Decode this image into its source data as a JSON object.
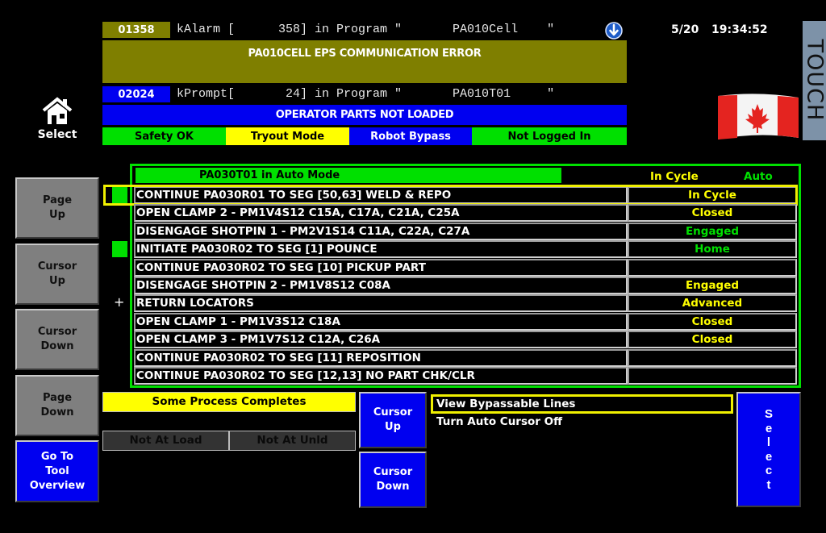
{
  "alarm": {
    "code": "01358",
    "line": "kAlarm [      358] in Program \"       PA010Cell    \"",
    "message": "PA010CELL EPS COMMUNICATION ERROR",
    "icon": "scroll-down-circle-icon",
    "code_color": "#7f7f00"
  },
  "prompt": {
    "code": "02024",
    "line": "kPrompt[       24] in Program \"       PA010T01     \"",
    "message": "OPERATOR PARTS NOT LOADED",
    "code_color": "#0000f0"
  },
  "status_strip": [
    {
      "label": "Safety OK",
      "bg": "#00e000",
      "fg": "#000000"
    },
    {
      "label": "Tryout Mode",
      "bg": "#ffff00",
      "fg": "#000000"
    },
    {
      "label": "Robot Bypass",
      "bg": "#0000f0",
      "fg": "#ffffff"
    },
    {
      "label": "Not Logged In",
      "bg": "#00e000",
      "fg": "#000000"
    }
  ],
  "datetime": {
    "date": "5/20",
    "time": "19:34:52"
  },
  "home": {
    "icon": "home-icon",
    "label": "Select"
  },
  "touch_label": "TOUCH",
  "flag": {
    "icon": "canada-flag-icon"
  },
  "sidebar": {
    "page_up": "Page\nUp",
    "cursor_up": "Cursor\nUp",
    "cursor_down": "Cursor\nDown",
    "page_down": "Page\nDown",
    "go_to_tool_overview": "Go To\nTool\nOverview"
  },
  "sequence": {
    "header": {
      "title": "PA030T01 in Auto Mode",
      "cycle_state": "In Cycle",
      "mode": "Auto"
    },
    "rows": [
      {
        "step": "CONTINUE PA030R01 TO SEG [50,63] WELD & REPO",
        "state": "In Cycle",
        "state_color": "#ffff00",
        "marker": "green-block",
        "selected": true
      },
      {
        "step": "OPEN CLAMP 2 - PM1V4S12 C15A, C17A, C21A, C25A",
        "state": "Closed",
        "state_color": "#ffff00",
        "marker": ""
      },
      {
        "step": "DISENGAGE SHOTPIN 1 - PM2V1S14 C11A, C22A, C27A",
        "state": "Engaged",
        "state_color": "#00e000",
        "marker": ""
      },
      {
        "step": "INITIATE PA030R02 TO SEG [1] POUNCE",
        "state": "Home",
        "state_color": "#00e000",
        "marker": "green-block"
      },
      {
        "step": "CONTINUE PA030R02 TO SEG [10] PICKUP PART",
        "state": "",
        "state_color": "#ffff00",
        "marker": ""
      },
      {
        "step": "DISENGAGE SHOTPIN 2 - PM1V8S12 C08A",
        "state": "Engaged",
        "state_color": "#ffff00",
        "marker": ""
      },
      {
        "step": "RETURN LOCATORS",
        "state": "Advanced",
        "state_color": "#ffff00",
        "marker": "plus"
      },
      {
        "step": "OPEN CLAMP 1 - PM1V3S12 C18A",
        "state": "Closed",
        "state_color": "#ffff00",
        "marker": ""
      },
      {
        "step": "OPEN CLAMP 3 - PM1V7S12 C12A, C26A",
        "state": "Closed",
        "state_color": "#ffff00",
        "marker": ""
      },
      {
        "step": "CONTINUE PA030R02 TO SEG [11] REPOSITION",
        "state": "",
        "state_color": "#ffff00",
        "marker": ""
      },
      {
        "step": "CONTINUE PA030R02 TO SEG [12,13] NO PART CHK/CLR",
        "state": "",
        "state_color": "#ffff00",
        "marker": ""
      }
    ]
  },
  "bottom": {
    "process_banner": "Some Process Completes",
    "not_at_load": "Not At Load",
    "not_at_unld": "Not At Unld",
    "cursor_up": "Cursor\nUp",
    "cursor_down": "Cursor\nDown",
    "menu": [
      {
        "label": "View Bypassable Lines",
        "selected": true
      },
      {
        "label": "Turn Auto Cursor Off",
        "selected": false
      }
    ],
    "select": "S\ne\nl\ne\nc\nt"
  }
}
